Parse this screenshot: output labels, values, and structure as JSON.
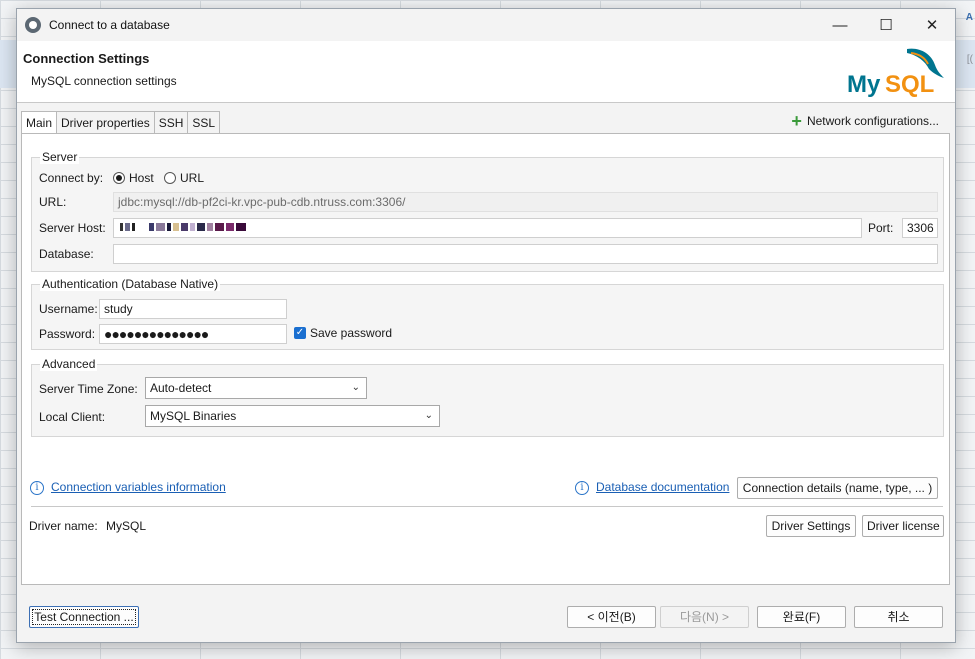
{
  "window": {
    "title": "Connect to a database"
  },
  "header": {
    "title": "Connection Settings",
    "subtitle": "MySQL connection settings",
    "logo_text": "MySQL"
  },
  "tabs": [
    {
      "label": "Main",
      "active": true
    },
    {
      "label": "Driver properties"
    },
    {
      "label": "SSH"
    },
    {
      "label": "SSL"
    }
  ],
  "network_config_label": "Network configurations...",
  "server": {
    "legend": "Server",
    "connect_by_label": "Connect by:",
    "host_option": "Host",
    "url_option": "URL",
    "url_label": "URL:",
    "url_value": "jdbc:mysql://db-pf2ci-kr.vpc-pub-cdb.ntruss.com:3306/",
    "server_host_label": "Server Host:",
    "port_label": "Port:",
    "port_value": "3306",
    "database_label": "Database:",
    "database_value": ""
  },
  "auth": {
    "legend": "Authentication (Database Native)",
    "username_label": "Username:",
    "username_value": "study",
    "password_label": "Password:",
    "password_value": "●●●●●●●●●●●●●●",
    "save_password_label": "Save password"
  },
  "advanced": {
    "legend": "Advanced",
    "timezone_label": "Server Time Zone:",
    "timezone_value": "Auto-detect",
    "local_client_label": "Local Client:",
    "local_client_value": "MySQL Binaries"
  },
  "links": {
    "conn_vars": "Connection variables information",
    "db_docs": "Database documentation",
    "conn_details_button": "Connection details (name, type, ... )"
  },
  "driver": {
    "name_label": "Driver name:",
    "name_value": "MySQL",
    "settings_button": "Driver Settings",
    "license_button": "Driver license"
  },
  "footer": {
    "test_button": "Test Connection ...",
    "back_button": "< 이전(B)",
    "next_button": "다음(N) >",
    "finish_button": "완료(F)",
    "cancel_button": "취소"
  },
  "colors": {
    "accent": "#1a6fd0",
    "link": "#1a5fb4",
    "mysql_blue": "#00758f",
    "mysql_orange": "#f29111"
  }
}
